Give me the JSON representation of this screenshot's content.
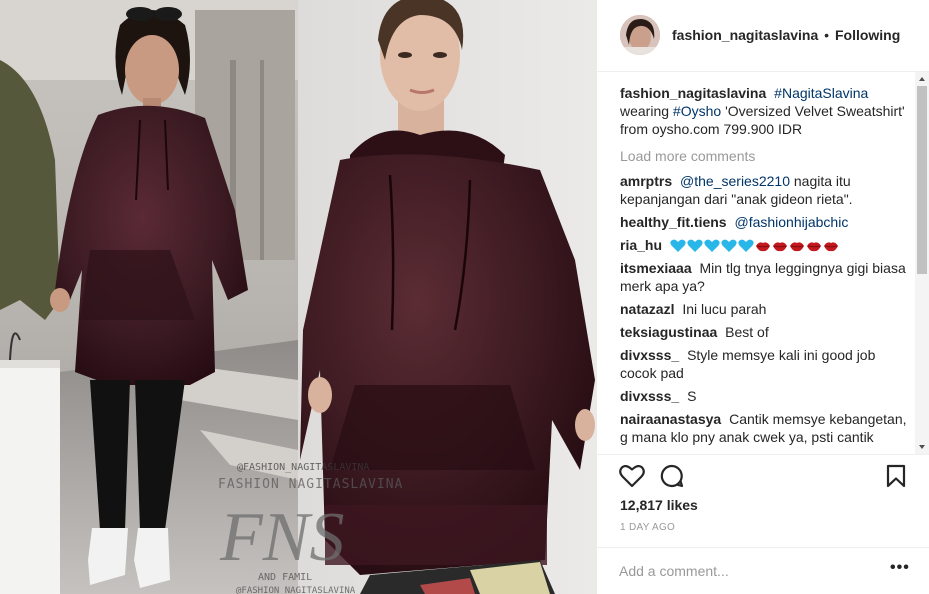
{
  "post": {
    "username": "fashion_nagitaslavina",
    "separator": "•",
    "follow_status": "Following"
  },
  "watermark": {
    "handle": "@FASHION_NAGITASLAVINA",
    "name": "FASHION NAGITASLAVINA",
    "monogram": "FNS",
    "tagline": "AND FAMIL",
    "handle_bottom": "@FASHION_NAGITASLAVINA"
  },
  "caption": {
    "username": "fashion_nagitaslavina",
    "hashtag1": "#NagitaSlavina",
    "text1": "wearing",
    "hashtag2": "#Oysho",
    "text2": "'Oversized Velvet Sweatshirt' from oysho.com 799.900 IDR"
  },
  "load_more": "Load more comments",
  "comments": [
    {
      "user": "amrptrs",
      "mention": "@the_series2210",
      "text": "nagita itu kepanjangan dari \"anak gideon rieta\"."
    },
    {
      "user": "healthy_fit.tiens",
      "mention": "@fashionhijabchic",
      "text": ""
    },
    {
      "user": "ria_hu",
      "emoji": [
        "blue-heart",
        "blue-heart",
        "blue-heart",
        "blue-heart",
        "blue-heart",
        "lips",
        "lips",
        "lips",
        "lips",
        "lips"
      ]
    },
    {
      "user": "itsmexiaaa",
      "text": "Min tlg tnya leggingnya gigi biasa merk apa ya?"
    },
    {
      "user": "natazazl",
      "text": "Ini lucu parah"
    },
    {
      "user": "teksiagustinaa",
      "text": "Best of"
    },
    {
      "user": "divxsss_",
      "text": "Style memsye kali ini good job cocok pad"
    },
    {
      "user": "divxsss_",
      "text": "S"
    },
    {
      "user": "nairaanastasya",
      "text": "Cantik memsye kebangetan, g mana klo pny anak cwek ya, psti cantik"
    }
  ],
  "likes": "12,817 likes",
  "time_ago": "1 DAY AGO",
  "add_comment_placeholder": "Add a comment...",
  "more_label": "•••",
  "colors": {
    "velvet": "#3b1a22",
    "link": "#003569",
    "muted": "#999999",
    "heart_blue": "#29b6e8",
    "lips_red": "#c3181e"
  }
}
